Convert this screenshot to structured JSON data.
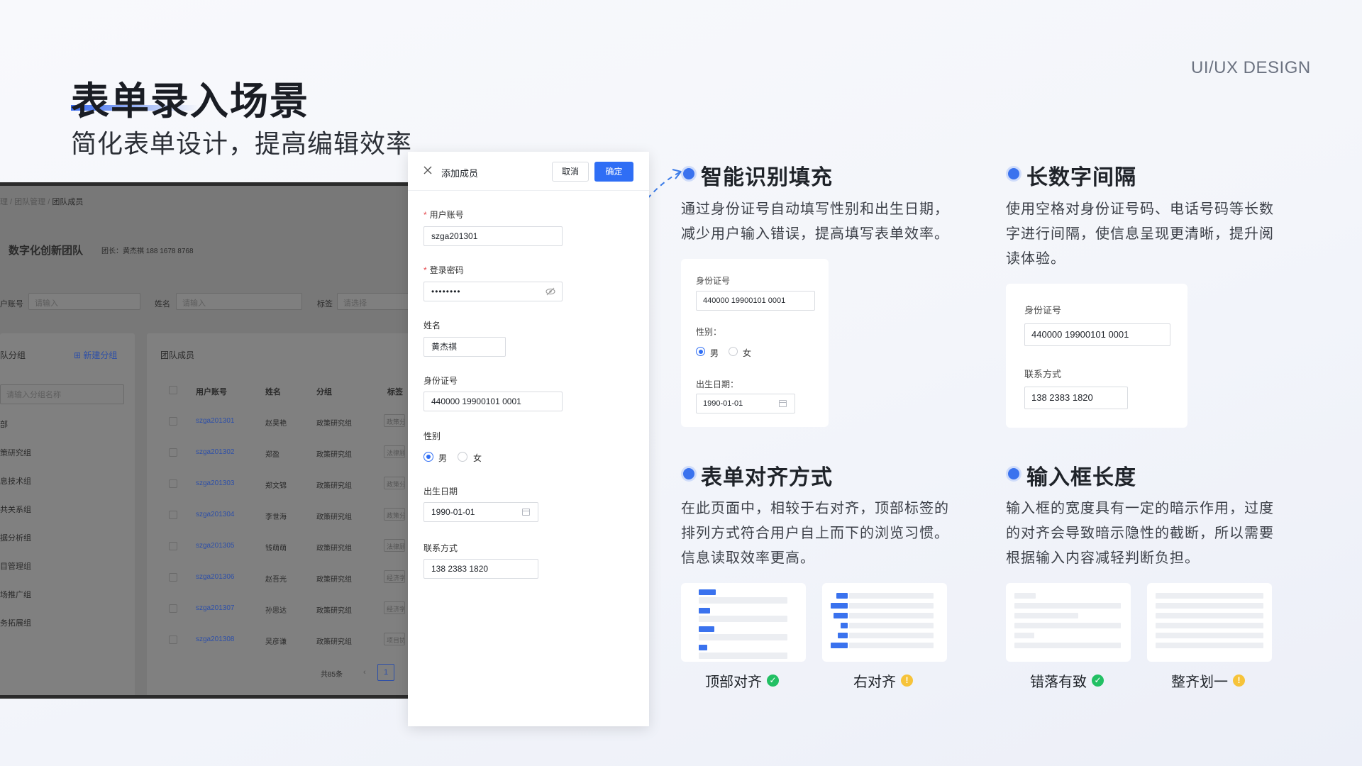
{
  "header": {
    "brand": "UI/UX DESIGN",
    "title": "表单录入场景",
    "subtitle": "简化表单设计，提高编辑效率"
  },
  "background_app": {
    "breadcrumb": [
      "理",
      "团队管理",
      "团队成员"
    ],
    "team_name": "数字化创新团队",
    "leader": "团长：黄杰祺 188 1678 8768",
    "filters": [
      {
        "label": "户账号",
        "placeholder": "请输入"
      },
      {
        "label": "姓名",
        "placeholder": "请输入"
      },
      {
        "label": "标签",
        "placeholder": "请选择"
      }
    ],
    "groups_title": "队分组",
    "new_group": "新建分组",
    "group_search_placeholder": "请输入分组名称",
    "groups": [
      "部",
      "策研究组",
      "息技术组",
      "共关系组",
      "据分析组",
      "目管理组",
      "场推广组",
      "务拓展组"
    ],
    "members_title": "团队成员",
    "columns": [
      "用户账号",
      "姓名",
      "分组",
      "标签"
    ],
    "rows": [
      {
        "account": "szga201301",
        "name": "赵昊艳",
        "group": "政策研究组",
        "tag": "政策分"
      },
      {
        "account": "szga201302",
        "name": "郑盈",
        "group": "政策研究组",
        "tag": "法律顾"
      },
      {
        "account": "szga201303",
        "name": "郑文锦",
        "group": "政策研究组",
        "tag": "政策分"
      },
      {
        "account": "szga201304",
        "name": "李世海",
        "group": "政策研究组",
        "tag": "政策分"
      },
      {
        "account": "szga201305",
        "name": "钱萌萌",
        "group": "政策研究组",
        "tag": "法律顾"
      },
      {
        "account": "szga201306",
        "name": "赵吾光",
        "group": "政策研究组",
        "tag": "经济学"
      },
      {
        "account": "szga201307",
        "name": "孙思达",
        "group": "政策研究组",
        "tag": "经济学"
      },
      {
        "account": "szga201308",
        "name": "吴彦谦",
        "group": "政策研究组",
        "tag": "项目协"
      }
    ],
    "total": "共85条",
    "page": "1"
  },
  "modal": {
    "title": "添加成员",
    "cancel": "取消",
    "confirm": "确定",
    "account_label": "用户账号",
    "account_value": "szga201301",
    "password_label": "登录密码",
    "password_value": "••••••••",
    "name_label": "姓名",
    "name_value": "黄杰祺",
    "id_label": "身份证号",
    "id_value": "440000 19900101 0001",
    "gender_label": "性别",
    "gender_male": "男",
    "gender_female": "女",
    "birth_label": "出生日期",
    "birth_value": "1990-01-01",
    "phone_label": "联系方式",
    "phone_value": "138 2383 1820"
  },
  "sections": {
    "smart_fill": {
      "title": "智能识别填充",
      "text": [
        "通过身份证号自动填写性别和出生日期，",
        "减少用户输入错误，提高填写表单效率。"
      ],
      "card": {
        "id_label": "身份证号",
        "id_value": "440000 19900101 0001",
        "gender_label": "性别：",
        "male": "男",
        "female": "女",
        "birth_label": "出生日期：",
        "birth_value": "1990-01-01"
      }
    },
    "number_spacing": {
      "title": "长数字间隔",
      "text": [
        "使用空格对身份证号码、电话号码等长数",
        "字进行间隔，使信息呈现更清晰，提升阅",
        "读体验。"
      ],
      "card": {
        "id_label": "身份证号",
        "id_value": "440000 19900101 0001",
        "phone_label": "联系方式",
        "phone_value": "138 2383 1820"
      }
    },
    "alignment": {
      "title": "表单对齐方式",
      "text": [
        "在此页面中，相较于右对齐，顶部标签的",
        "排列方式符合用户自上而下的浏览习惯。",
        "信息读取效率更高。"
      ],
      "options": [
        {
          "caption": "顶部对齐",
          "status": "ok"
        },
        {
          "caption": "右对齐",
          "status": "warn"
        }
      ]
    },
    "input_length": {
      "title": "输入框长度",
      "text": [
        "输入框的宽度具有一定的暗示作用，过度",
        "的对齐会导致暗示隐性的截断，所以需要",
        "根据输入内容减轻判断负担。"
      ],
      "options": [
        {
          "caption": "错落有致",
          "status": "ok"
        },
        {
          "caption": "整齐划一",
          "status": "warn"
        }
      ]
    }
  },
  "colors": {
    "accent": "#2f6ef5",
    "ok": "#22c064",
    "warn": "#f6c33a",
    "dash": "#3b7be8"
  }
}
